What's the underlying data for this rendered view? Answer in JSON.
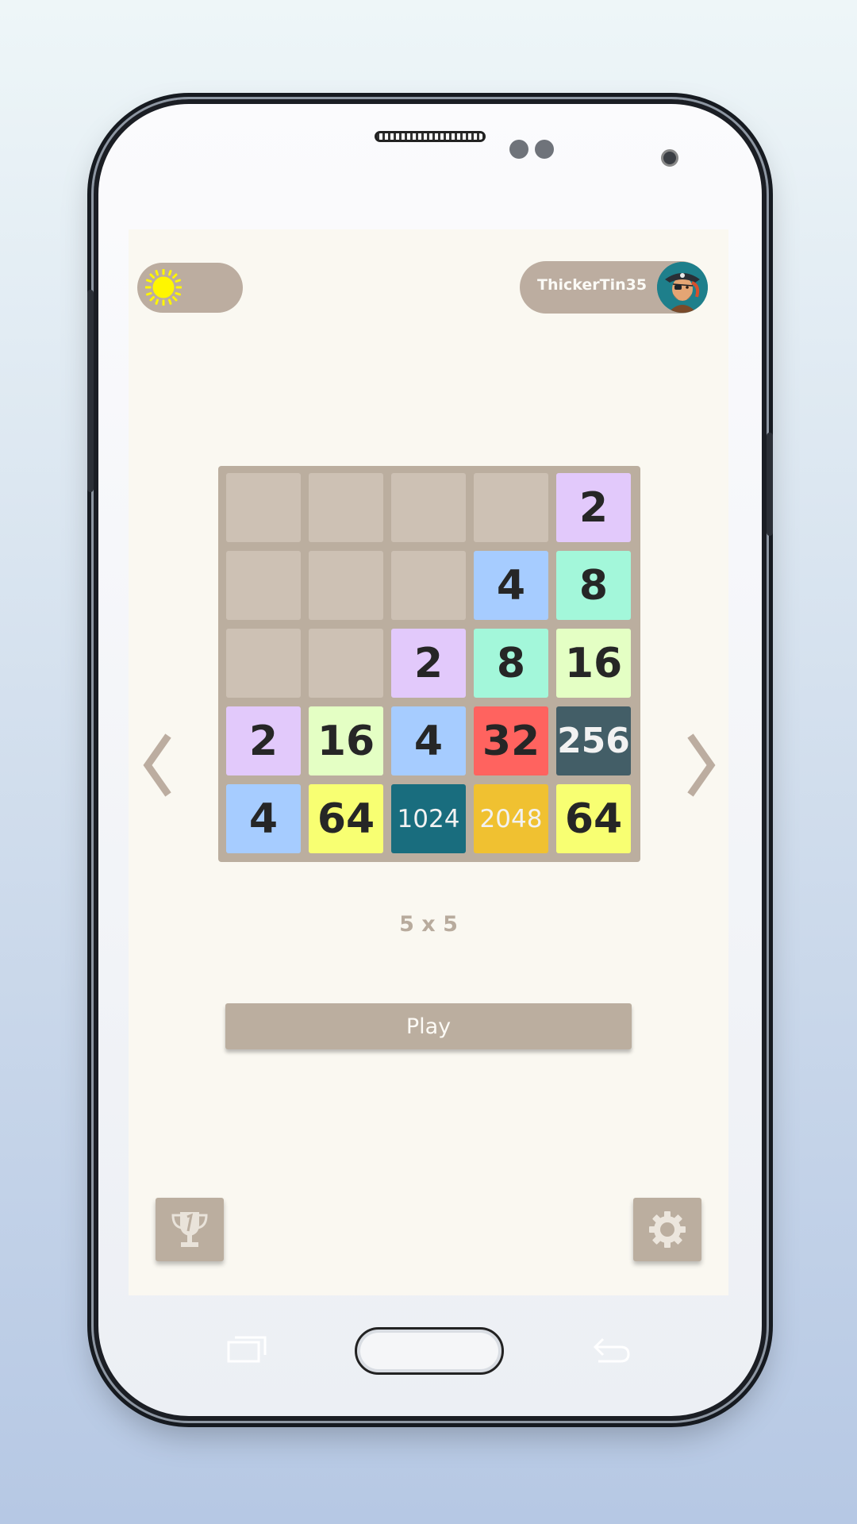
{
  "header": {
    "username": "ThickerTin35"
  },
  "board": {
    "tiles": [
      [
        "",
        "",
        "",
        "",
        "2"
      ],
      [
        "",
        "",
        "",
        "4",
        "8"
      ],
      [
        "",
        "",
        "2",
        "8",
        "16"
      ],
      [
        "2",
        "16",
        "4",
        "32",
        "256"
      ],
      [
        "4",
        "64",
        "1024",
        "2048",
        "64"
      ]
    ],
    "size_label": "5 x 5"
  },
  "actions": {
    "play_label": "Play"
  },
  "icons": {
    "theme": "sun-icon",
    "prev": "chevron-left-icon",
    "next": "chevron-right-icon",
    "leaderboard": "trophy-icon",
    "settings": "gear-icon"
  },
  "colors": {
    "background": "#faf8f1",
    "board": "#bbae9f",
    "empty": "#cdc1b4",
    "t2": "#e2c9fb",
    "t4": "#a6ccff",
    "t8": "#a3f7da",
    "t16": "#e4ffc4",
    "t32": "#ff635f",
    "t64": "#f8ff72",
    "t256": "#435e67",
    "t1024": "#196d7e",
    "t2048": "#f0c131",
    "sun": "#fff600"
  }
}
